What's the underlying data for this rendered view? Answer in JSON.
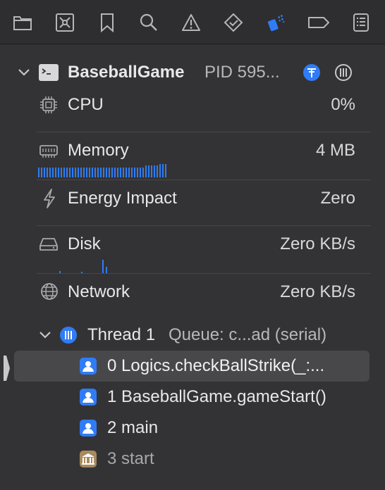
{
  "toolbar": {
    "icons": [
      "folder-icon",
      "source-control-icon",
      "bookmark-icon",
      "search-icon",
      "warning-icon",
      "test-icon",
      "debug-icon",
      "breakpoint-icon",
      "report-icon"
    ]
  },
  "process": {
    "name": "BaseballGame",
    "pid": "PID 595..."
  },
  "gauges": [
    {
      "label": "CPU",
      "value": "0%"
    },
    {
      "label": "Memory",
      "value": "4 MB"
    },
    {
      "label": "Energy Impact",
      "value": "Zero"
    },
    {
      "label": "Disk",
      "value": "Zero KB/s"
    },
    {
      "label": "Network",
      "value": "Zero KB/s"
    }
  ],
  "thread": {
    "name": "Thread 1",
    "queue": "Queue: c...ad (serial)"
  },
  "frames": [
    {
      "label": "0 Logics.checkBallStrike(_:...",
      "kind": "user"
    },
    {
      "label": "1 BaseballGame.gameStart()",
      "kind": "user"
    },
    {
      "label": "2 main",
      "kind": "user"
    },
    {
      "label": "3 start",
      "kind": "system"
    }
  ],
  "colors": {
    "accent": "#2f7cf6",
    "system_frame": "#a98a5d"
  }
}
